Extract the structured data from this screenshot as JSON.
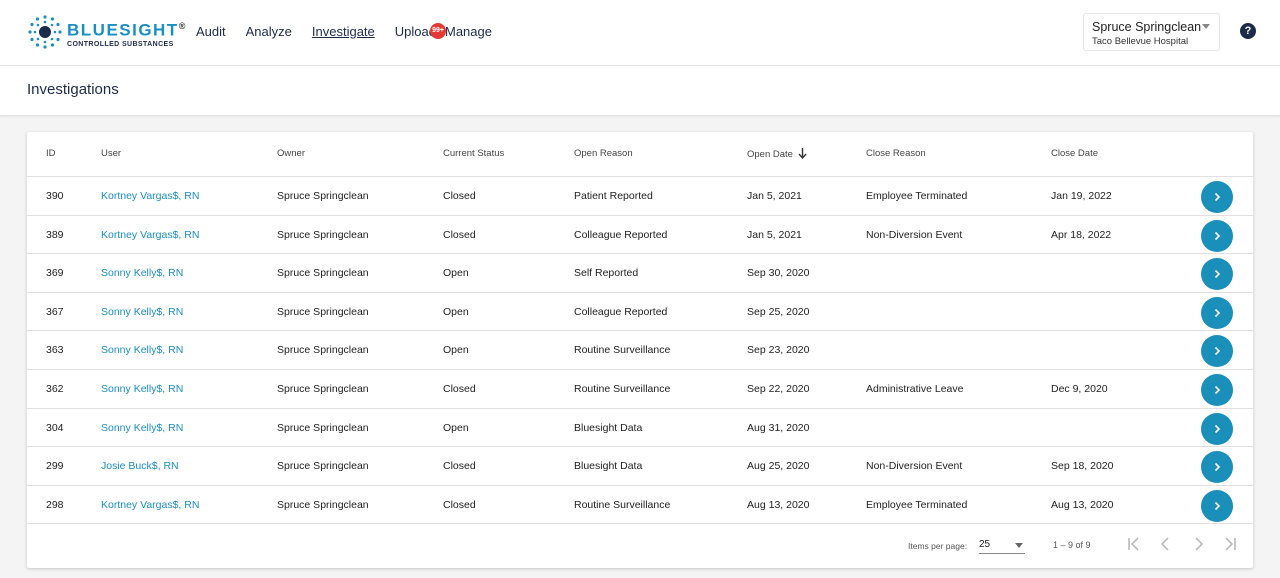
{
  "brand": {
    "name": "BLUESIGHT",
    "registered": "®",
    "subtitle": "CONTROLLED SUBSTANCES"
  },
  "nav": {
    "audit": "Audit",
    "analyze": "Analyze",
    "investigate": "Investigate",
    "upload": "Upload",
    "upload_badge": "99+",
    "manage": "Manage"
  },
  "user_menu": {
    "name": "Spruce Springclean",
    "hospital": "Taco Bellevue Hospital"
  },
  "help": {
    "label": "?"
  },
  "page": {
    "title": "Investigations"
  },
  "table": {
    "headers": {
      "id": "ID",
      "user": "User",
      "owner": "Owner",
      "status": "Current Status",
      "open_reason": "Open Reason",
      "open_date": "Open Date",
      "close_reason": "Close Reason",
      "close_date": "Close Date"
    },
    "sort": {
      "column": "open_date",
      "direction": "desc"
    },
    "rows": [
      {
        "id": "390",
        "user": "Kortney Vargas$, RN",
        "owner": "Spruce Springclean",
        "status": "Closed",
        "open_reason": "Patient Reported",
        "open_date": "Jan 5, 2021",
        "close_reason": "Employee Terminated",
        "close_date": "Jan 19, 2022"
      },
      {
        "id": "389",
        "user": "Kortney Vargas$, RN",
        "owner": "Spruce Springclean",
        "status": "Closed",
        "open_reason": "Colleague Reported",
        "open_date": "Jan 5, 2021",
        "close_reason": "Non-Diversion Event",
        "close_date": "Apr 18, 2022"
      },
      {
        "id": "369",
        "user": "Sonny Kelly$, RN",
        "owner": "Spruce Springclean",
        "status": "Open",
        "open_reason": "Self Reported",
        "open_date": "Sep 30, 2020",
        "close_reason": "",
        "close_date": ""
      },
      {
        "id": "367",
        "user": "Sonny Kelly$, RN",
        "owner": "Spruce Springclean",
        "status": "Open",
        "open_reason": "Colleague Reported",
        "open_date": "Sep 25, 2020",
        "close_reason": "",
        "close_date": ""
      },
      {
        "id": "363",
        "user": "Sonny Kelly$, RN",
        "owner": "Spruce Springclean",
        "status": "Open",
        "open_reason": "Routine Surveillance",
        "open_date": "Sep 23, 2020",
        "close_reason": "",
        "close_date": ""
      },
      {
        "id": "362",
        "user": "Sonny Kelly$, RN",
        "owner": "Spruce Springclean",
        "status": "Closed",
        "open_reason": "Routine Surveillance",
        "open_date": "Sep 22, 2020",
        "close_reason": "Administrative Leave",
        "close_date": "Dec 9, 2020"
      },
      {
        "id": "304",
        "user": "Sonny Kelly$, RN",
        "owner": "Spruce Springclean",
        "status": "Open",
        "open_reason": "Bluesight Data",
        "open_date": "Aug 31, 2020",
        "close_reason": "",
        "close_date": ""
      },
      {
        "id": "299",
        "user": "Josie Buck$, RN",
        "owner": "Spruce Springclean",
        "status": "Closed",
        "open_reason": "Bluesight Data",
        "open_date": "Aug 25, 2020",
        "close_reason": "Non-Diversion Event",
        "close_date": "Sep 18, 2020"
      },
      {
        "id": "298",
        "user": "Kortney Vargas$, RN",
        "owner": "Spruce Springclean",
        "status": "Closed",
        "open_reason": "Routine Surveillance",
        "open_date": "Aug 13, 2020",
        "close_reason": "Employee Terminated",
        "close_date": "Aug 13, 2020"
      }
    ],
    "row_action_icon": "chevron-right-icon"
  },
  "paginator": {
    "items_per_page_label": "Items per page:",
    "items_per_page": "25",
    "range": "1 – 9 of 9"
  },
  "colors": {
    "brand": "#1a8fc4",
    "navy": "#1c2b4a",
    "badge": "#e53935",
    "action": "#1a8fb9"
  }
}
